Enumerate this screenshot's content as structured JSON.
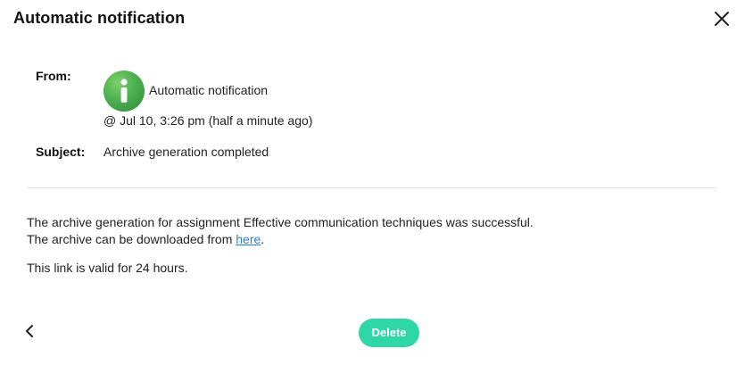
{
  "dialog": {
    "title": "Automatic notification",
    "close_icon": "close-icon"
  },
  "message": {
    "from_label": "From:",
    "sender": {
      "avatar_icon": "info-icon",
      "avatar_color": "#4caf50",
      "name": "Automatic notification"
    },
    "timestamp": "@ Jul 10, 3:26 pm (half a minute ago)",
    "subject_label": "Subject:",
    "subject": "Archive generation completed",
    "body": {
      "line1": "The archive generation for assignment Effective communication techniques was successful.",
      "line2_prefix": "The archive can be downloaded from ",
      "line2_link": "here",
      "line2_suffix": ".",
      "line3": "This link is valid for 24 hours."
    }
  },
  "footer": {
    "back_icon": "chevron-left-icon",
    "delete_label": "Delete",
    "delete_color": "#2fd6a6"
  }
}
